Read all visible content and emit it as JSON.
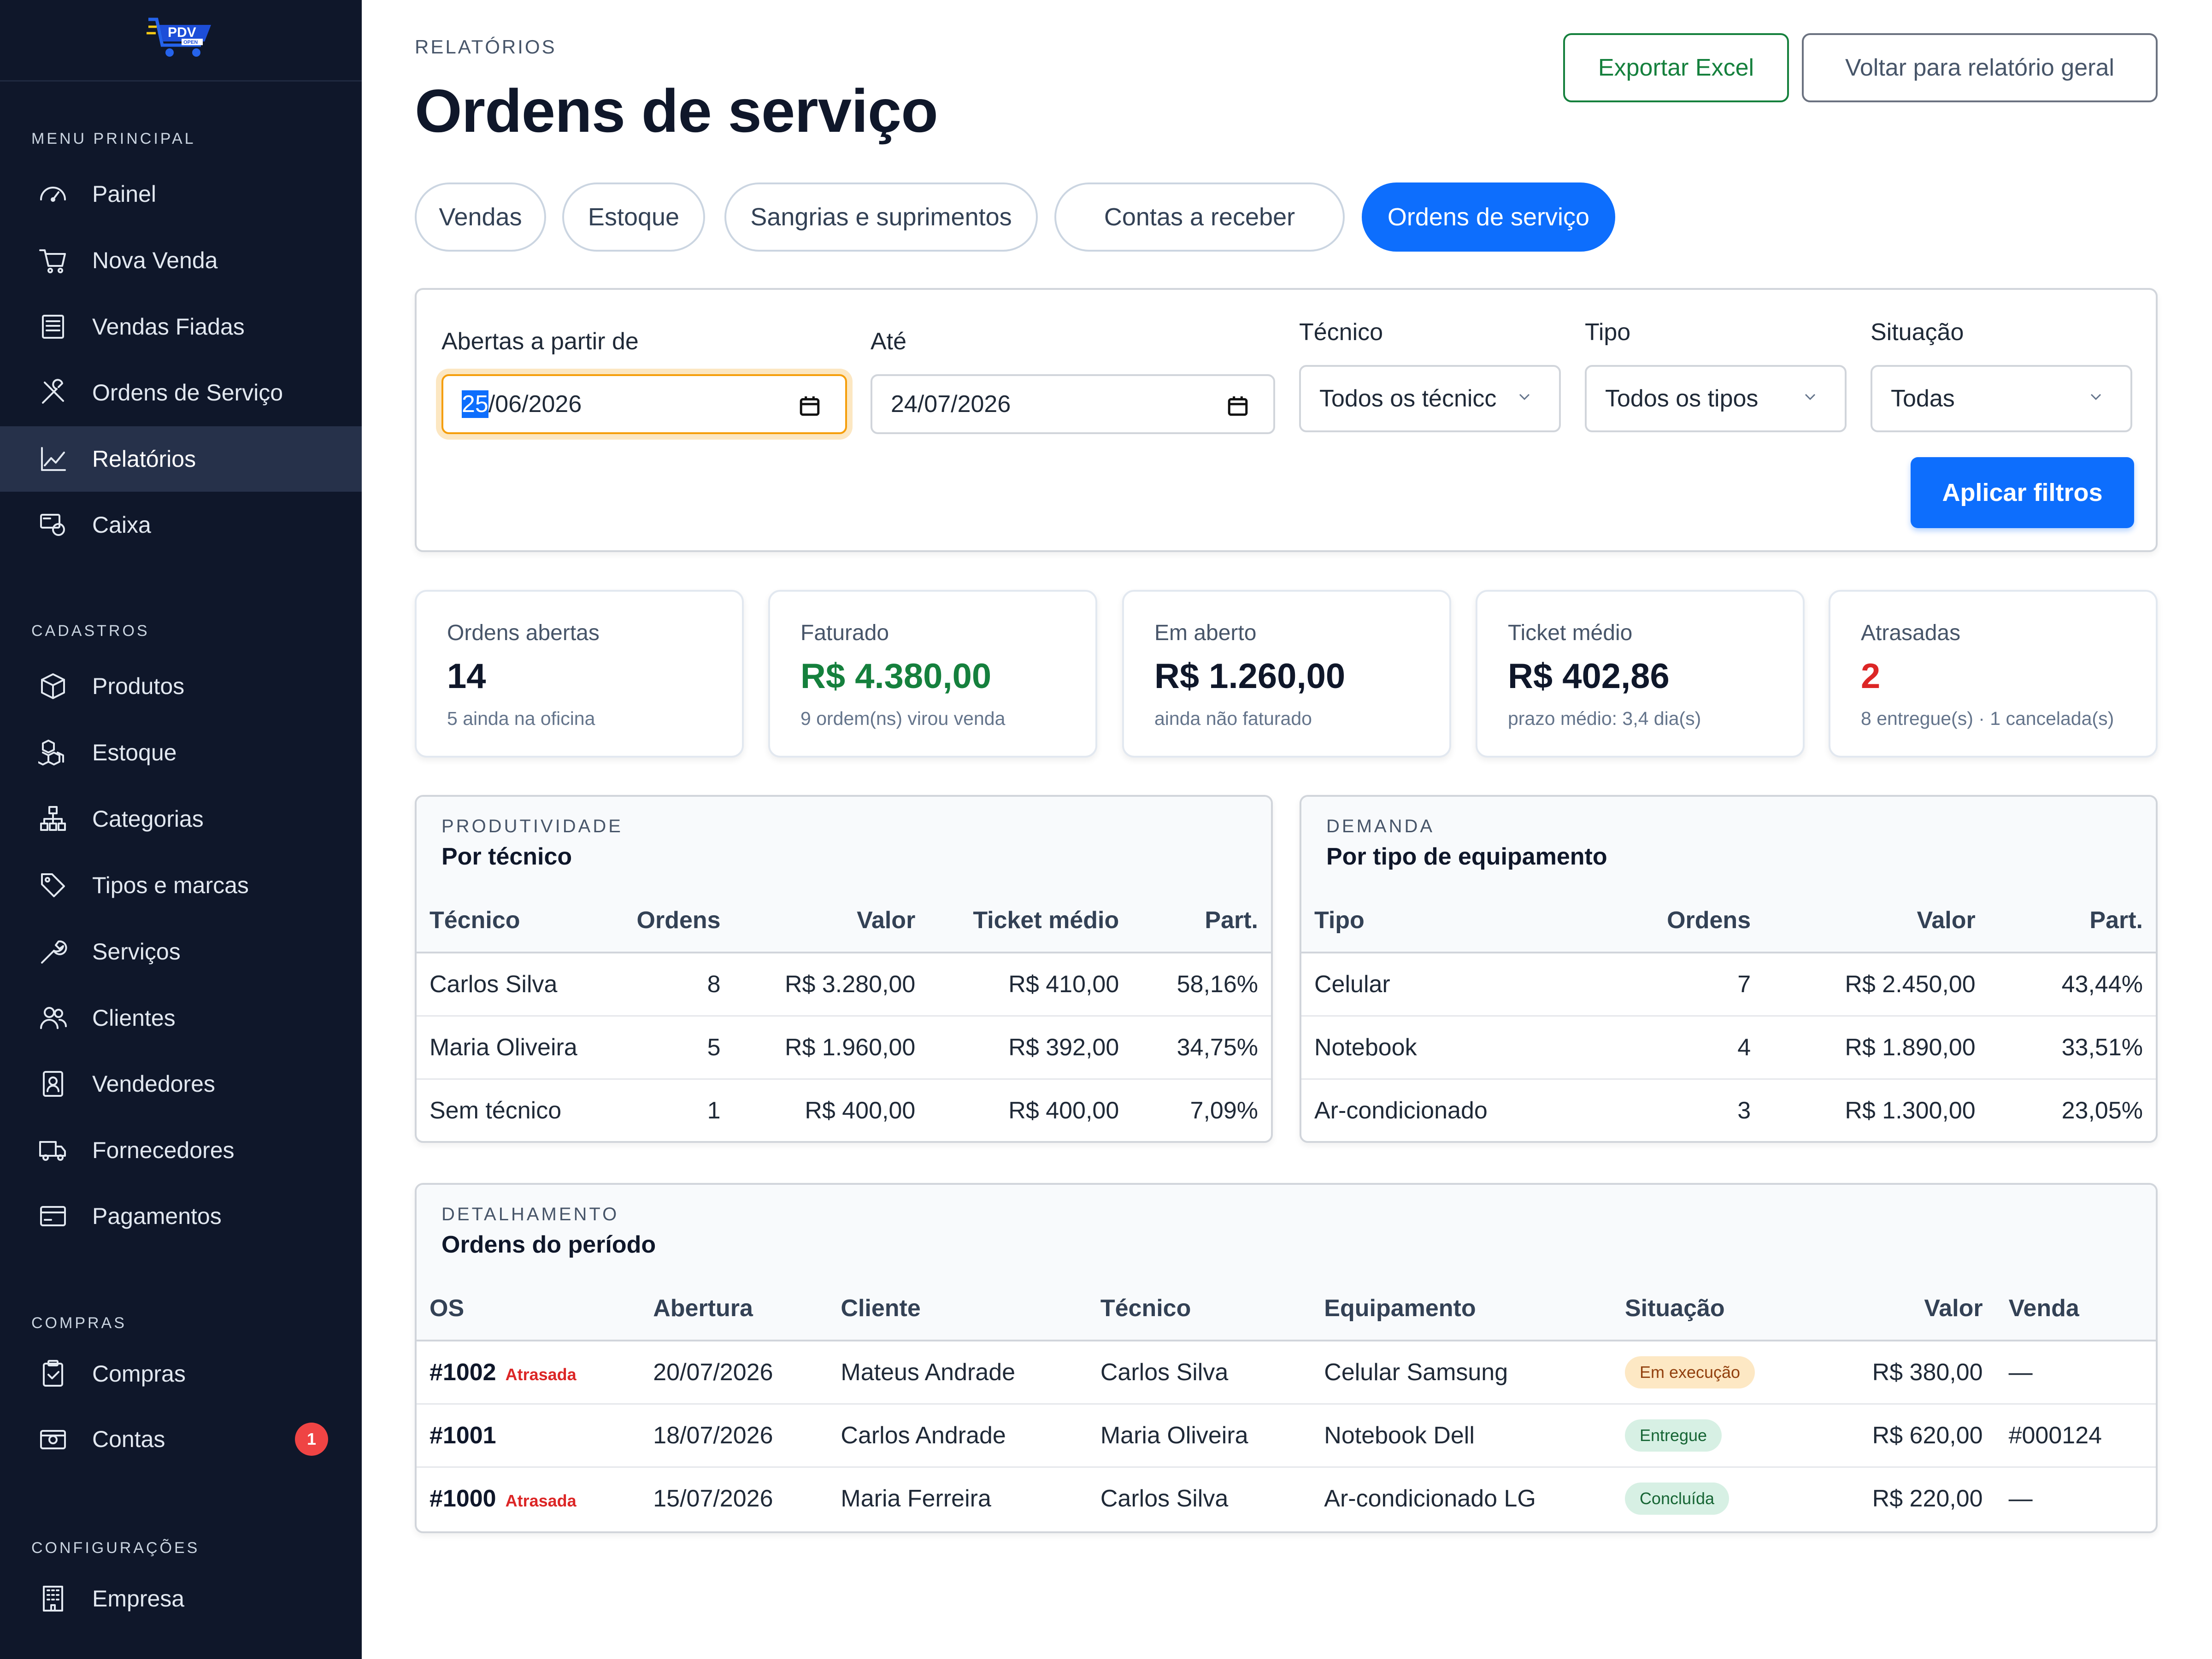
{
  "brand": {
    "logo_text": "PDV",
    "logo_subtext": "OPEN"
  },
  "sidebar": {
    "sections": [
      {
        "title": "MENU PRINCIPAL",
        "items": [
          {
            "label": "Painel",
            "icon": "dashboard-icon"
          },
          {
            "label": "Nova Venda",
            "icon": "cart-icon"
          },
          {
            "label": "Vendas Fiadas",
            "icon": "ledger-icon"
          },
          {
            "label": "Ordens de Serviço",
            "icon": "tools-icon"
          },
          {
            "label": "Relatórios",
            "icon": "chart-line-icon",
            "active": true
          },
          {
            "label": "Caixa",
            "icon": "cash-register-icon"
          }
        ]
      },
      {
        "title": "CADASTROS",
        "items": [
          {
            "label": "Produtos",
            "icon": "box-icon"
          },
          {
            "label": "Estoque",
            "icon": "boxes-icon"
          },
          {
            "label": "Categorias",
            "icon": "hierarchy-icon"
          },
          {
            "label": "Tipos e marcas",
            "icon": "tags-icon"
          },
          {
            "label": "Serviços",
            "icon": "wrench-icon"
          },
          {
            "label": "Clientes",
            "icon": "users-icon"
          },
          {
            "label": "Vendedores",
            "icon": "badge-person-icon"
          },
          {
            "label": "Fornecedores",
            "icon": "truck-icon"
          },
          {
            "label": "Pagamentos",
            "icon": "credit-card-icon"
          }
        ]
      },
      {
        "title": "COMPRAS",
        "items": [
          {
            "label": "Compras",
            "icon": "clipboard-icon"
          },
          {
            "label": "Contas",
            "icon": "wallet-icon",
            "badge": "1"
          }
        ]
      },
      {
        "title": "CONFIGURAÇÕES",
        "items": [
          {
            "label": "Empresa",
            "icon": "building-icon"
          }
        ]
      }
    ]
  },
  "header": {
    "breadcrumb": "RELATÓRIOS",
    "title": "Ordens de serviço",
    "export_label": "Exportar Excel",
    "back_label": "Voltar para relatório geral"
  },
  "tabs": [
    "Vendas",
    "Estoque",
    "Sangrias e suprimentos",
    "Contas a receber",
    "Ordens de serviço"
  ],
  "active_tab": "Ordens de serviço",
  "filters": {
    "from_label": "Abertas a partir de",
    "from_value_day": "25",
    "from_value_rest": "/06/2026",
    "to_label": "Até",
    "to_value": "24/07/2026",
    "tech_label": "Técnico",
    "tech_value": "Todos os técnicc",
    "type_label": "Tipo",
    "type_value": "Todos os tipos",
    "status_label": "Situação",
    "status_value": "Todas",
    "apply_label": "Aplicar filtros"
  },
  "kpis": [
    {
      "label": "Ordens abertas",
      "value": "14",
      "sub": "5 ainda na oficina",
      "color": "#0f172a"
    },
    {
      "label": "Faturado",
      "value": "R$ 4.380,00",
      "sub": "9 ordem(ns) virou venda",
      "color": "#15803d"
    },
    {
      "label": "Em aberto",
      "value": "R$ 1.260,00",
      "sub": "ainda não faturado",
      "color": "#0f172a"
    },
    {
      "label": "Ticket médio",
      "value": "R$ 402,86",
      "sub": "prazo médio: 3,4 dia(s)",
      "color": "#0f172a"
    },
    {
      "label": "Atrasadas",
      "value": "2",
      "sub": "8 entregue(s) · 1 cancelada(s)",
      "color": "#dc2626"
    }
  ],
  "by_tech": {
    "eyebrow": "PRODUTIVIDADE",
    "title": "Por técnico",
    "columns": [
      "Técnico",
      "Ordens",
      "Valor",
      "Ticket médio",
      "Part."
    ],
    "rows": [
      [
        "Carlos Silva",
        "8",
        "R$ 3.280,00",
        "R$ 410,00",
        "58,16%"
      ],
      [
        "Maria Oliveira",
        "5",
        "R$ 1.960,00",
        "R$ 392,00",
        "34,75%"
      ],
      [
        "Sem técnico",
        "1",
        "R$ 400,00",
        "R$ 400,00",
        "7,09%"
      ]
    ]
  },
  "by_type": {
    "eyebrow": "DEMANDA",
    "title": "Por tipo de equipamento",
    "columns": [
      "Tipo",
      "Ordens",
      "Valor",
      "Part."
    ],
    "rows": [
      [
        "Celular",
        "7",
        "R$ 2.450,00",
        "43,44%"
      ],
      [
        "Notebook",
        "4",
        "R$ 1.890,00",
        "33,51%"
      ],
      [
        "Ar-condicionado",
        "3",
        "R$ 1.300,00",
        "23,05%"
      ]
    ]
  },
  "orders": {
    "eyebrow": "DETALHAMENTO",
    "title": "Ordens do período",
    "columns": [
      "OS",
      "Abertura",
      "Cliente",
      "Técnico",
      "Equipamento",
      "Situação",
      "Valor",
      "Venda"
    ],
    "rows": [
      {
        "os": "#1002",
        "late": "Atrasada",
        "date": "20/07/2026",
        "client": "Mateus Andrade",
        "tech": "Carlos Silva",
        "equip": "Celular Samsung",
        "status": "Em execução",
        "status_kind": "exec",
        "value": "R$ 380,00",
        "sale": "—"
      },
      {
        "os": "#1001",
        "late": "",
        "date": "18/07/2026",
        "client": "Carlos Andrade",
        "tech": "Maria Oliveira",
        "equip": "Notebook Dell",
        "status": "Entregue",
        "status_kind": "ok",
        "value": "R$ 620,00",
        "sale": "#000124"
      },
      {
        "os": "#1000",
        "late": "Atrasada",
        "date": "15/07/2026",
        "client": "Maria Ferreira",
        "tech": "Carlos Silva",
        "equip": "Ar-condicionado LG",
        "status": "Concluída",
        "status_kind": "ok",
        "value": "R$ 220,00",
        "sale": "—"
      }
    ]
  }
}
